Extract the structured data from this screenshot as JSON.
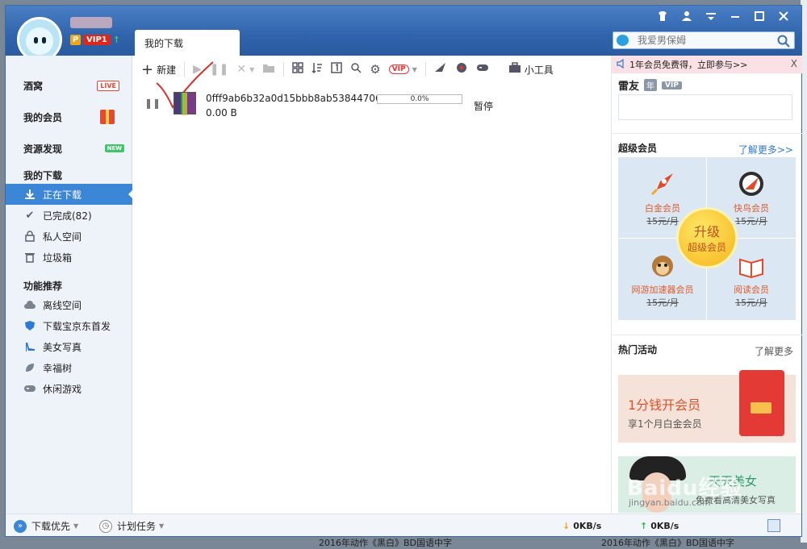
{
  "window": {
    "tab_title": "我的下载",
    "search_placeholder": "我爱男保姆"
  },
  "user": {
    "vip_label": "VIP1"
  },
  "sidebar": {
    "top_items": [
      {
        "label": "酒窝",
        "badge": "LIVE"
      },
      {
        "label": "我的会员"
      },
      {
        "label": "资源发现",
        "badge": "NEW"
      }
    ],
    "section_download": "我的下载",
    "download_items": [
      {
        "label": "正在下载"
      },
      {
        "label": "已完成(82)"
      },
      {
        "label": "私人空间"
      },
      {
        "label": "垃圾箱"
      }
    ],
    "section_features": "功能推荐",
    "feature_items": [
      {
        "label": "离线空间"
      },
      {
        "label": "下载宝京东首发"
      },
      {
        "label": "美女写真"
      },
      {
        "label": "幸福树"
      },
      {
        "label": "休闲游戏"
      }
    ]
  },
  "toolbar": {
    "new_label": "新建",
    "tools_label": "小工具"
  },
  "download": {
    "filename": "0fff9ab6b32a0d15bbb8ab53844706...",
    "size": "0.00 B",
    "progress": "0.0%",
    "progress_value": 0.0,
    "status": "暂停"
  },
  "right_panel": {
    "promo_text": "1年会员免费得，立即参与>>",
    "promo_close": "X",
    "leiyou_title": "雷友",
    "leiyou_year": "年",
    "leiyou_vip": "VIP",
    "super_vip_title": "超级会员",
    "super_vip_more": "了解更多>>",
    "vip_cells": [
      {
        "name": "白金会员",
        "price": "15元/月"
      },
      {
        "name": "快鸟会员",
        "price": "15元/月"
      },
      {
        "name": "网游加速器会员",
        "price": "15元/月"
      },
      {
        "name": "阅读会员",
        "price": "15元/月"
      }
    ],
    "upgrade_line1": "升级",
    "upgrade_line2": "超级会员",
    "hot_title": "热门活动",
    "hot_more": "了解更多",
    "banner1_title": "1分钱开会员",
    "banner1_sub": "享1个月白金会员",
    "banner2_title": "天天美女",
    "banner2_sub": "免费看高清美女写真"
  },
  "bottombar": {
    "priority_label": "下载优先",
    "schedule_label": "计划任务",
    "down_speed": "0KB/s",
    "up_speed": "0KB/s"
  },
  "watermark": {
    "text": "Baidu经验",
    "url": "jingyan.baidu.com"
  },
  "background": {
    "text1": "2016年动作《黑白》BD国语中字",
    "text2": "2016年动作《黑白》BD国语中字"
  }
}
